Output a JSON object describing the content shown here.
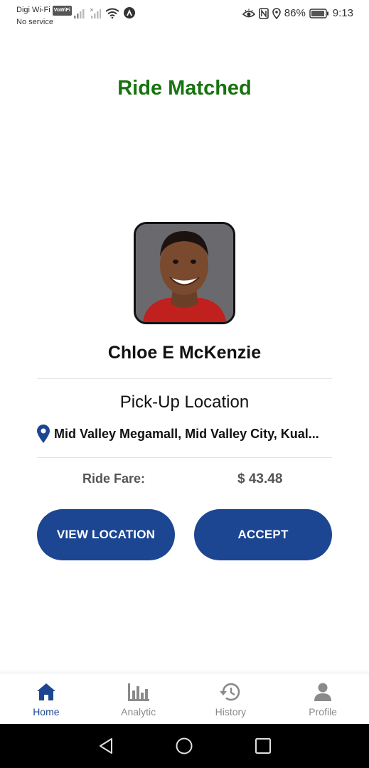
{
  "status_bar": {
    "carrier": "Digi Wi-Fi",
    "vowifi_badge": "VoWiFi",
    "carrier_line2": "No service",
    "battery": "86%",
    "time": "9:13"
  },
  "page_title": "Ride Matched",
  "driver": {
    "name": "Chloe E McKenzie"
  },
  "pickup": {
    "heading": "Pick-Up Location",
    "address": "Mid Valley Megamall, Mid Valley City, Kual..."
  },
  "fare": {
    "label": "Ride Fare:",
    "value": "$ 43.48"
  },
  "buttons": {
    "view_location": "VIEW LOCATION",
    "accept": "ACCEPT"
  },
  "bottom_nav": {
    "items": [
      {
        "label": "Home",
        "icon": "home-icon",
        "active": true
      },
      {
        "label": "Analytic",
        "icon": "bar-chart-icon",
        "active": false
      },
      {
        "label": "History",
        "icon": "history-icon",
        "active": false
      },
      {
        "label": "Profile",
        "icon": "person-icon",
        "active": false
      }
    ]
  },
  "colors": {
    "title_green": "#17730f",
    "primary_blue": "#1c4691",
    "muted_text": "#555555",
    "nav_inactive": "#8a8a8a"
  }
}
